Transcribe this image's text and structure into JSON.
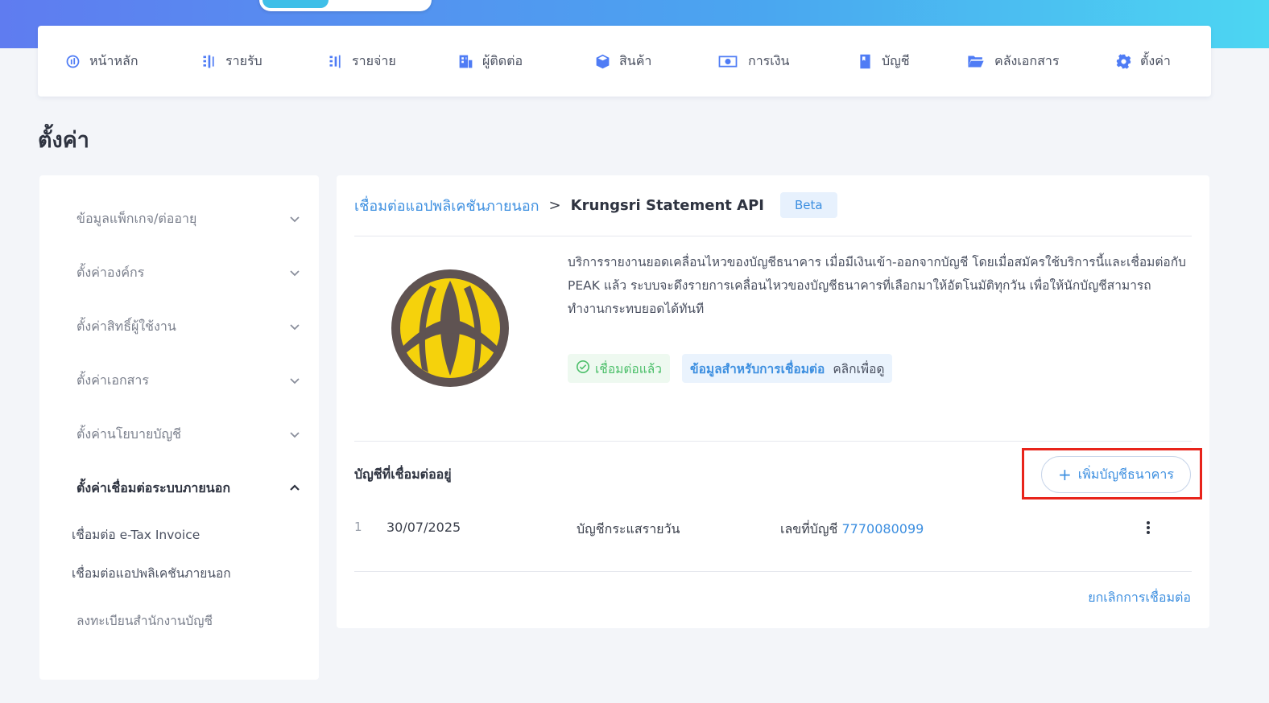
{
  "nav": {
    "items": [
      {
        "icon": "dashboard-icon",
        "label": "หน้าหลัก"
      },
      {
        "icon": "income-list-icon",
        "label": "รายรับ"
      },
      {
        "icon": "expense-list-icon",
        "label": "รายจ่าย"
      },
      {
        "icon": "contacts-icon",
        "label": "ผู้ติดต่อ"
      },
      {
        "icon": "product-box-icon",
        "label": "สินค้า"
      },
      {
        "icon": "money-icon",
        "label": "การเงิน"
      },
      {
        "icon": "ledger-book-icon",
        "label": "บัญชี"
      },
      {
        "icon": "folder-icon",
        "label": "คลังเอกสาร"
      },
      {
        "icon": "gear-icon",
        "label": "ตั้งค่า"
      }
    ],
    "accent": "#4f7cf5"
  },
  "page": {
    "title": "ตั้งค่า"
  },
  "sidebar": {
    "items": [
      {
        "label": "ข้อมูลแพ็กเกจ/ต่ออายุ",
        "expanded": false
      },
      {
        "label": "ตั้งค่าองค์กร",
        "expanded": false
      },
      {
        "label": "ตั้งค่าสิทธิ์ผู้ใช้งาน",
        "expanded": false
      },
      {
        "label": "ตั้งค่าเอกสาร",
        "expanded": false
      },
      {
        "label": "ตั้งค่านโยบายบัญชี",
        "expanded": false
      },
      {
        "label": "ตั้งค่าเชื่อมต่อระบบภายนอก",
        "expanded": true
      }
    ],
    "sub_items": [
      {
        "label": "เชื่อมต่อ e-Tax Invoice"
      },
      {
        "label": "เชื่อมต่อแอปพลิเคชันภายนอก"
      },
      {
        "label": "ลงทะเบียนสำนักงานบัญชี"
      }
    ]
  },
  "main": {
    "breadcrumb": {
      "parent": "เชื่อมต่อแอปพลิเคชันภายนอก",
      "separator": ">",
      "current": "Krungsri Statement API",
      "badge": "Beta"
    },
    "logo": {
      "icon": "krungsri-logo",
      "ring_color": "#5f5352",
      "fill_color": "#f5d20c"
    },
    "description": "บริการรายงานยอดเคลื่อนไหวของบัญชีธนาคาร เมื่อมีเงินเข้า-ออกจากบัญชี โดยเมื่อสมัครใช้บริการนี้และเชื่อมต่อกับ PEAK แล้ว ระบบจะดึงรายการเคลื่อนไหวของบัญชีธนาคารที่เลือกมาให้อัตโนมัติทุกวัน เพื่อให้นักบัญชีสามารถทำงานกระทบยอดได้ทันที",
    "status_tag": {
      "icon": "check-circle-icon",
      "label": "เชื่อมต่อแล้ว"
    },
    "info_tag": {
      "link": "ข้อมูลสำหรับการเชื่อมต่อ",
      "hint": "คลิกเพื่อดู"
    },
    "section_title": "บัญชีที่เชื่อมต่ออยู่",
    "add_button": {
      "icon": "plus-icon",
      "label": "เพิ่มบัญชีธนาคาร"
    },
    "accounts": [
      {
        "index": "1",
        "date": "30/07/2025",
        "type": "บัญชีกระแสรายวัน",
        "account_label": "เลขที่บัญชี",
        "account_no": "7770080099"
      }
    ],
    "cancel_link": "ยกเลิกการเชื่อมต่อ"
  },
  "colors": {
    "link": "#3d8fe0",
    "highlight": "#e8241b",
    "success": "#4cbf6a"
  }
}
